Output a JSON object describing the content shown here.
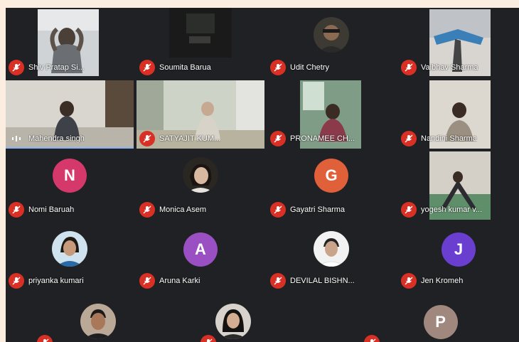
{
  "participants": [
    {
      "name": "Shiv Pratap Si...",
      "type": "video",
      "muted": true
    },
    {
      "name": "Soumita Barua",
      "type": "video",
      "muted": true
    },
    {
      "name": "Udit Chetry",
      "type": "photo",
      "muted": true
    },
    {
      "name": "Vaibhav Sharma",
      "type": "video",
      "muted": true
    },
    {
      "name": "Mahendra singh",
      "type": "video",
      "muted": false
    },
    {
      "name": "SATYAJIT KUM...",
      "type": "video",
      "muted": true
    },
    {
      "name": "PRONAMEE CH...",
      "type": "video",
      "muted": true
    },
    {
      "name": "Nandini Sharma",
      "type": "video",
      "muted": true
    },
    {
      "name": "Nomi Baruah",
      "type": "initial",
      "initial": "N",
      "color": "#d5386a",
      "muted": true
    },
    {
      "name": "Monica Asem",
      "type": "photo",
      "muted": true
    },
    {
      "name": "Gayatri Sharma",
      "type": "initial",
      "initial": "G",
      "color": "#e0603a",
      "muted": true
    },
    {
      "name": "yogesh kumar v...",
      "type": "video",
      "muted": true
    },
    {
      "name": "priyanka kumari",
      "type": "photo",
      "muted": true
    },
    {
      "name": "Aruna Karki",
      "type": "initial",
      "initial": "A",
      "color": "#9a4fc2",
      "muted": true
    },
    {
      "name": "DEVILAL BISHN...",
      "type": "photo",
      "muted": true
    },
    {
      "name": "Jen Kromeh",
      "type": "initial",
      "initial": "J",
      "color": "#6a3fd0",
      "muted": true
    },
    {
      "name": "",
      "type": "photo",
      "muted": true
    },
    {
      "name": "",
      "type": "photo",
      "muted": true
    },
    {
      "name": "",
      "type": "initial",
      "initial": "P",
      "color": "#a1887f",
      "muted": true
    }
  ],
  "colors": {
    "mic_off": "#d93025",
    "background": "#202124"
  }
}
